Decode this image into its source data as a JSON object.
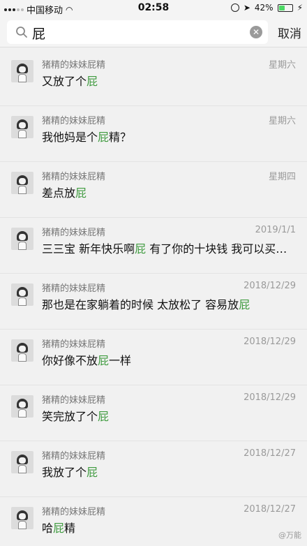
{
  "status_bar": {
    "carrier": "中国移动",
    "time": "02:58",
    "battery": "42%",
    "battery_level": 0.42
  },
  "search": {
    "query": "屁",
    "cancel_label": "取消"
  },
  "results": [
    {
      "name": "猪精的妹妹屁精",
      "date": "星期六",
      "before": "又放了个",
      "keyword": "屁",
      "after": ""
    },
    {
      "name": "猪精的妹妹屁精",
      "date": "星期六",
      "before": "我他妈是个",
      "keyword": "屁",
      "after": "精？"
    },
    {
      "name": "猪精的妹妹屁精",
      "date": "星期四",
      "before": "差点放",
      "keyword": "屁",
      "after": ""
    },
    {
      "name": "猪精的妹妹屁精",
      "date": "2019/1/1",
      "before": "三三宝 新年快乐啊",
      "keyword": "屁",
      "after": " 有了你的十块钱 我可以买…"
    },
    {
      "name": "猪精的妹妹屁精",
      "date": "2018/12/29",
      "before": "那也是在家躺着的时候 太放松了 容易放",
      "keyword": "屁",
      "after": ""
    },
    {
      "name": "猪精的妹妹屁精",
      "date": "2018/12/29",
      "before": "你好像不放",
      "keyword": "屁",
      "after": "一样"
    },
    {
      "name": "猪精的妹妹屁精",
      "date": "2018/12/29",
      "before": "笑完放了个",
      "keyword": "屁",
      "after": ""
    },
    {
      "name": "猪精的妹妹屁精",
      "date": "2018/12/27",
      "before": "我放了个",
      "keyword": "屁",
      "after": ""
    },
    {
      "name": "猪精的妹妹屁精",
      "date": "2018/12/27",
      "before": "哈",
      "keyword": "屁",
      "after": "精"
    }
  ],
  "watermark": "@万能",
  "colors": {
    "highlight": "#3f9b3f",
    "battery": "#4cd964"
  }
}
